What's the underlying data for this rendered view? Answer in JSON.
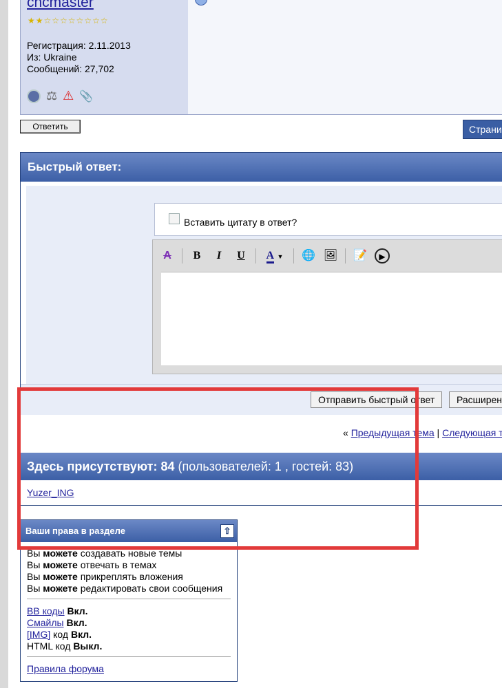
{
  "post": {
    "username": "cncmaster",
    "stars": "★★☆☆☆☆☆☆☆☆",
    "registration": "Регистрация: 2.11.2013",
    "from": "Из: Ukraine",
    "messages": "Сообщений: 27,702"
  },
  "buttons": {
    "reply": "Ответить",
    "pages": "Страни"
  },
  "quick_reply": {
    "title": "Быстрый ответ:",
    "quote_label": "Вставить цитату в ответ?",
    "toolbar": [
      "B",
      "I",
      "U",
      "A"
    ],
    "submit": "Отправить быстрый ответ",
    "advanced": "Расширен"
  },
  "nav": {
    "prev_prefix": "«",
    "prev": "Предыдущая тема",
    "divider": "|",
    "next": "Следующая т"
  },
  "online": {
    "title_bold": "Здесь присутствуют: 84",
    "title_rest": "(пользователей: 1 , гостей: 83)",
    "user": "Yuzer_ING"
  },
  "permissions": {
    "title": "Ваши права в разделе",
    "can": "можете",
    "you": "Вы",
    "lines": [
      "создавать новые темы",
      "отвечать в темах",
      "прикреплять вложения",
      "редактировать свои сообщения"
    ],
    "bb": "BB коды",
    "smiles": "Смайлы",
    "img": "[IMG]",
    "img_suffix": "код",
    "html": "HTML код",
    "on": "Вкл.",
    "off": "Выкл.",
    "rules": "Правила форума"
  },
  "colors": {
    "header": "#3c5fa6",
    "highlight": "#e23a3a",
    "link": "#22229c"
  }
}
